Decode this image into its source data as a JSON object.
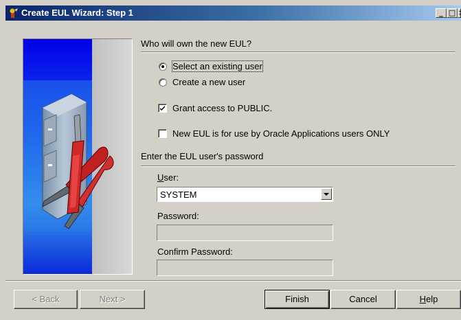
{
  "window": {
    "title": "Create EUL Wizard: Step 1",
    "minimize_label": "_",
    "maximize_label": "□",
    "close_label": "×"
  },
  "owner_section": {
    "title": "Who will own the new EUL?",
    "option_existing": "Select an existing user",
    "option_new": "Create a new user",
    "selected_option": "existing",
    "grant_public_label": "Grant access to PUBLIC.",
    "grant_public_checked": true,
    "oracle_apps_label": "New EUL is for use by Oracle Applications users ONLY",
    "oracle_apps_checked": false
  },
  "password_section": {
    "title": "Enter the EUL user's password",
    "user_label": "User:",
    "user_value": "SYSTEM",
    "password_label": "Password:",
    "password_value": "",
    "confirm_label": "Confirm Password:",
    "confirm_value": ""
  },
  "buttons": {
    "back": "< Back",
    "next": "Next >",
    "finish": "Finish",
    "cancel": "Cancel",
    "help": "Help"
  },
  "icons": {
    "title_icon": "wizard-icon",
    "illustration": "file-cabinet-tools-illustration"
  },
  "colors": {
    "titlebar_start": "#0a246a",
    "titlebar_end": "#a6caf0",
    "dialog_bg": "#d4d0c8",
    "illustration_blue": "#0000e8"
  }
}
